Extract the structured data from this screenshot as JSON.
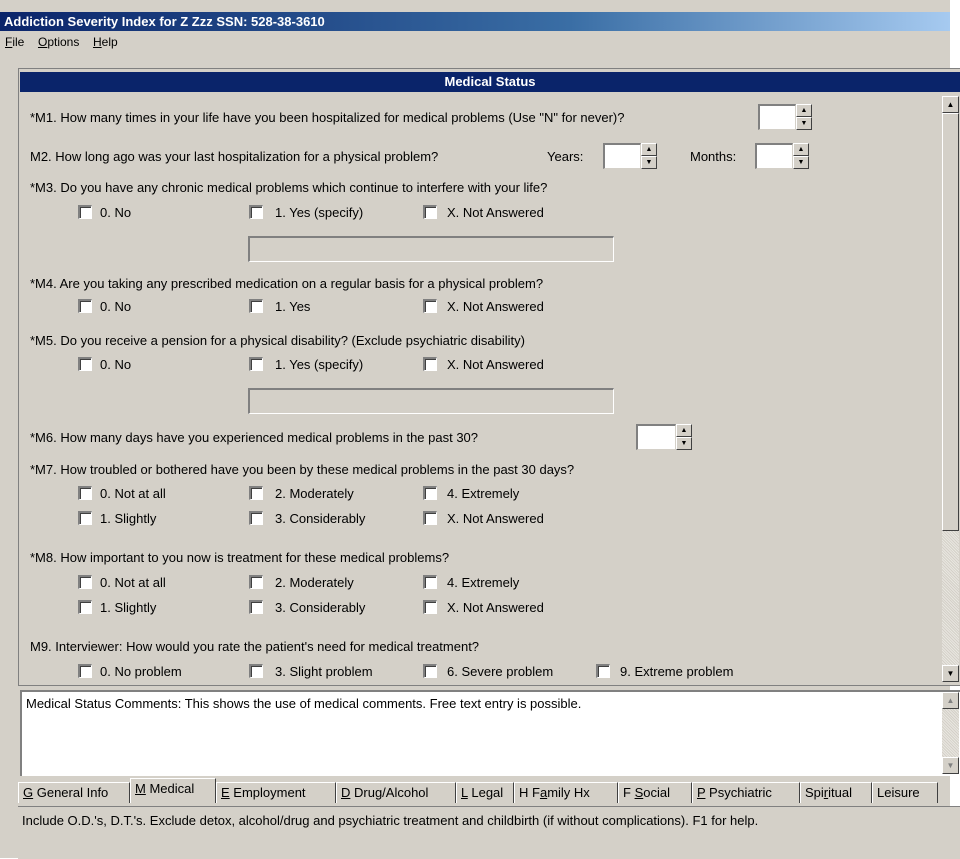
{
  "window": {
    "title": "Addiction Severity Index for  Z Zzz  SSN: 528-38-3610"
  },
  "menu": [
    {
      "key": "F",
      "rest": "ile"
    },
    {
      "key": "O",
      "rest": "ptions"
    },
    {
      "key": "H",
      "rest": "elp"
    }
  ],
  "section": {
    "title": "Medical Status"
  },
  "m1": {
    "text": "*M1. How many times in your life have you been hospitalized for medical problems (Use \"N\" for never)?",
    "value": ""
  },
  "m2": {
    "text": "M2. How long ago was your last hospitalization for a physical problem?",
    "years_label": "Years:",
    "months_label": "Months:",
    "years_value": "",
    "months_value": ""
  },
  "m3": {
    "text": "*M3. Do you have any chronic medical problems which continue to interfere with your life?",
    "options": [
      "0. No",
      "1. Yes (specify)",
      "X. Not Answered"
    ],
    "specify": ""
  },
  "m4": {
    "text": "*M4. Are you taking any prescribed medication on a regular basis for a physical problem?",
    "options": [
      "0. No",
      "1. Yes",
      "X. Not Answered"
    ]
  },
  "m5": {
    "text": "*M5. Do you receive a pension for a physical disability?  (Exclude psychiatric disability)",
    "options": [
      "0. No",
      "1. Yes (specify)",
      "X. Not Answered"
    ],
    "specify": ""
  },
  "m6": {
    "text": "*M6. How many days have you experienced medical problems in the past 30?",
    "value": ""
  },
  "m7": {
    "text": "*M7. How troubled or bothered have you been by these medical problems in the past 30 days?",
    "options": [
      "0. Not at all",
      "2. Moderately",
      "4. Extremely",
      "1. Slightly",
      "3. Considerably",
      "X. Not Answered"
    ]
  },
  "m8": {
    "text": "*M8. How important to you now is treatment for these medical problems?",
    "options": [
      "0. Not at all",
      "2. Moderately",
      "4. Extremely",
      "1. Slightly",
      "3. Considerably",
      "X. Not Answered"
    ]
  },
  "m9": {
    "text": "M9. Interviewer: How would you rate the patient's need for medical treatment?",
    "options": [
      "0. No problem",
      "3. Slight problem",
      "6. Severe problem",
      "9. Extreme problem"
    ]
  },
  "comments": {
    "text": "Medical Status Comments: This shows the use of medical comments. Free text entry is possible."
  },
  "tabs": [
    {
      "key": "G",
      "rest": " General Info"
    },
    {
      "key": "M",
      "rest": " Medical"
    },
    {
      "key": "E",
      "rest": " Employment"
    },
    {
      "key": "D",
      "rest": " Drug/Alcohol"
    },
    {
      "key": "L",
      "rest": " Legal"
    },
    {
      "pre": "H F",
      "key": "a",
      "rest": "mily Hx"
    },
    {
      "pre": "F ",
      "key": "S",
      "rest": "ocial"
    },
    {
      "key": "P",
      "rest": " Psychiatric"
    },
    {
      "pre": "Spi",
      "key": "r",
      "rest": "itual"
    },
    {
      "pre": "Leisure",
      "key": "",
      "rest": ""
    }
  ],
  "status": {
    "text": "Include O.D.'s, D.T.'s. Exclude detox, alcohol/drug and psychiatric treatment and childbirth (if without complications). F1 for help."
  }
}
